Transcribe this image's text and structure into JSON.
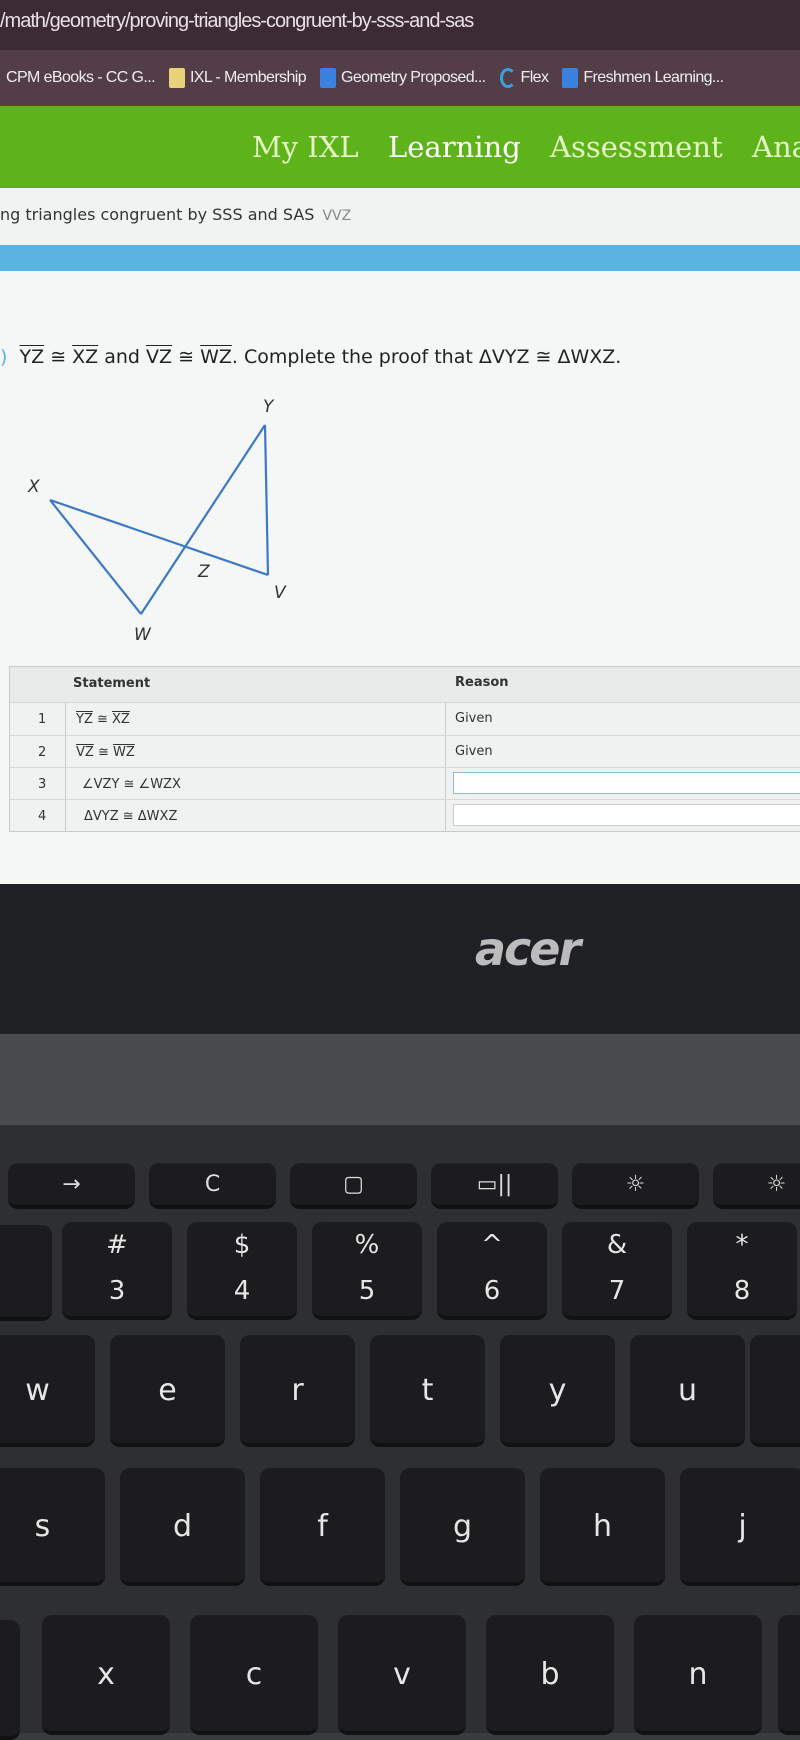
{
  "browser": {
    "url": "/math/geometry/proving-triangles-congruent-by-sss-and-sas",
    "bookmarks": [
      {
        "label": "CPM eBooks - CC G...",
        "icon": "none"
      },
      {
        "label": "IXL - Membership",
        "icon": "ixl-icon"
      },
      {
        "label": "Geometry Proposed...",
        "icon": "docs-icon"
      },
      {
        "label": "Flex",
        "icon": "flex-icon"
      },
      {
        "label": "Freshmen Learning...",
        "icon": "docs-icon"
      }
    ]
  },
  "nav": {
    "tabs": [
      "My IXL",
      "Learning",
      "Assessment",
      "Ana"
    ],
    "active": "Learning",
    "color": "#5fb31a"
  },
  "breadcrumb": {
    "text": "ng triangles congruent by SSS and SAS",
    "code": "VVZ"
  },
  "question": {
    "seg1": "YZ",
    "seg2": "XZ",
    "and": "and",
    "seg3": "VZ",
    "seg4": "WZ",
    "rest": ". Complete the proof that ΔVYZ ≅ ΔWXZ.",
    "cong": "≅"
  },
  "diagram": {
    "labels": {
      "X": "X",
      "Y": "Y",
      "Z": "Z",
      "V": "V",
      "W": "W"
    }
  },
  "proof": {
    "headers": {
      "statement": "Statement",
      "reason": "Reason"
    },
    "rows": [
      {
        "n": "1",
        "a": "YZ",
        "b": "XZ",
        "reason": "Given",
        "type": "seg"
      },
      {
        "n": "2",
        "a": "VZ",
        "b": "WZ",
        "reason": "Given",
        "type": "seg"
      },
      {
        "n": "3",
        "text": "∠VZY ≅ ∠WZX",
        "reason": ""
      },
      {
        "n": "4",
        "text": "ΔVYZ ≅ ΔWXZ",
        "reason": ""
      }
    ]
  },
  "laptop": {
    "brand": "acer"
  },
  "keys": {
    "fn": [
      "→",
      "C",
      "▢",
      "▭||",
      "☼",
      "☼"
    ],
    "num": [
      [
        "#",
        "3"
      ],
      [
        "$",
        "4"
      ],
      [
        "%",
        "5"
      ],
      [
        "^",
        "6"
      ],
      [
        "&",
        "7"
      ],
      [
        "*",
        "8"
      ]
    ],
    "r1": [
      "w",
      "e",
      "r",
      "t",
      "y",
      "u"
    ],
    "r2": [
      "s",
      "d",
      "f",
      "g",
      "h",
      "j"
    ],
    "r3": [
      "x",
      "c",
      "v",
      "b",
      "n"
    ]
  }
}
